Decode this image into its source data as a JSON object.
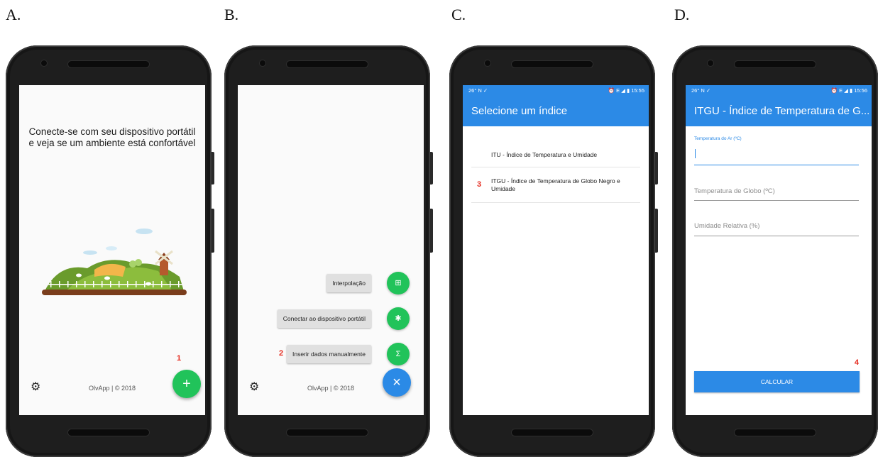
{
  "panels": [
    {
      "letter": "A."
    },
    {
      "letter": "B."
    },
    {
      "letter": "C."
    },
    {
      "letter": "D."
    }
  ],
  "screen_a": {
    "welcome_line1": "Conecte-se com seu dispositivo portátil",
    "welcome_line2": "e veja se um ambiente está confortável",
    "footer": "OlvApp | © 2018",
    "fab_icon": "+",
    "step_number": "1",
    "settings_icon": "gear-icon"
  },
  "screen_b": {
    "menu": [
      {
        "label": "Interpolação",
        "icon": "grid-icon",
        "glyph": "⊞"
      },
      {
        "label": "Conectar ao dispositivo portátil",
        "icon": "bluetooth-icon",
        "glyph": "✱"
      },
      {
        "label": "Inserir dados manualmente",
        "icon": "sigma-icon",
        "glyph": "Σ"
      }
    ],
    "step_number": "2",
    "close_icon": "×",
    "footer": "OlvApp | © 2018"
  },
  "screen_c": {
    "status_left": "26°  N  ✓",
    "status_right": "⏰ E ◢ ▮ 15:55",
    "title": "Selecione um índice",
    "items": [
      "ITU - Índice de Temperatura e Umidade",
      "ITGU - Índice de Temperatura de Globo Negro e Umidade"
    ],
    "step_number": "3"
  },
  "screen_d": {
    "status_left": "26°  N  ✓",
    "status_right": "⏰ E ◢ ▮ 15:56",
    "title": "ITGU - Índice de Temperatura de G...",
    "field_air_label": "Temperatura do Ar (ºC)",
    "field_globe_placeholder": "Temperatura de Globo (ºC)",
    "field_humidity_placeholder": "Umidade Relativa (%)",
    "button_label": "CALCULAR",
    "step_number": "4"
  },
  "colors": {
    "primary_blue": "#2c8ae6",
    "fab_green": "#21c35a",
    "step_red": "#e52b1f"
  }
}
